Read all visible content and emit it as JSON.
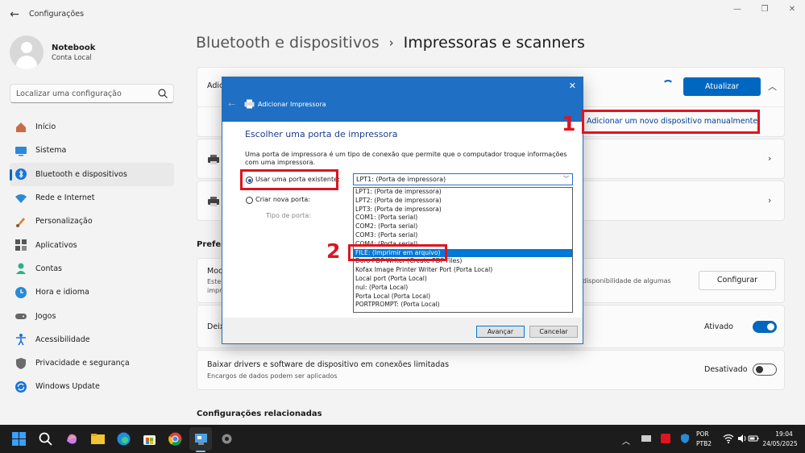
{
  "window": {
    "app_title": "Configurações"
  },
  "profile": {
    "name": "Notebook",
    "account": "Conta Local"
  },
  "search": {
    "placeholder": "Localizar uma configuração"
  },
  "sidebar": {
    "items": [
      {
        "label": "Início"
      },
      {
        "label": "Sistema"
      },
      {
        "label": "Bluetooth e dispositivos",
        "active": true
      },
      {
        "label": "Rede e Internet"
      },
      {
        "label": "Personalização"
      },
      {
        "label": "Aplicativos"
      },
      {
        "label": "Contas"
      },
      {
        "label": "Hora e idioma"
      },
      {
        "label": "Jogos"
      },
      {
        "label": "Acessibilidade"
      },
      {
        "label": "Privacidade e segurança"
      },
      {
        "label": "Windows Update"
      }
    ]
  },
  "breadcrumb": {
    "parent": "Bluetooth e dispositivos",
    "separator": "›",
    "current": "Impressoras e scanners"
  },
  "main": {
    "add_card_label": "Adici",
    "refresh_button": "Atualizar",
    "add_manual_link": "Adicionar um novo dispositivo manualmente",
    "preferences_title": "Prefer",
    "mode_label": "Moc",
    "mode_sub_1": "Este",
    "mode_sub_2": "impr",
    "mode_right_text": "disponibilidade de algumas",
    "configure_button": "Configurar",
    "default_label": "Deix",
    "toggle_on_label": "Ativado",
    "download_title": "Baixar drivers e software de dispositivo em conexões limitadas",
    "download_sub": "Encargos de dados podem ser aplicados",
    "toggle_off_label": "Desativado",
    "related_title": "Configurações relacionadas"
  },
  "dialog": {
    "title": "Adicionar Impressora",
    "heading": "Escolher uma porta de impressora",
    "description": "Uma porta de impressora é um tipo de conexão que permite que o computador troque informações com uma impressora.",
    "use_existing_label": "Usar uma porta existente:",
    "create_new_label": "Criar nova porta:",
    "port_type_label": "Tipo de porta:",
    "selected_port": "LPT1: (Porta de impressora)",
    "ports": [
      "LPT1: (Porta de impressora)",
      "LPT2: (Porta de impressora)",
      "LPT3: (Porta de impressora)",
      "COM1: (Porta serial)",
      "COM2: (Porta serial)",
      "COM3: (Porta serial)",
      "COM4: (Porta serial)",
      "FILE: (Imprimir em arquivo)",
      "Doro PDF Writer (Create PDF Files)",
      "Kofax Image Printer Writer Port (Porta Local)",
      "Local port (Porta Local)",
      "nul: (Porta Local)",
      "Porta Local (Porta Local)",
      "PORTPROMPT: (Porta Local)"
    ],
    "highlighted_index": 7,
    "next_button": "Avançar",
    "cancel_button": "Cancelar"
  },
  "annotations": {
    "step1": "1",
    "step2": "2"
  },
  "taskbar": {
    "lang_1": "POR",
    "lang_2": "PTB2",
    "time": "19:04",
    "date": "24/05/2025"
  },
  "colors": {
    "accent": "#0067c0",
    "annotation": "#e0141e",
    "dialog_header": "#1f6fc4"
  }
}
